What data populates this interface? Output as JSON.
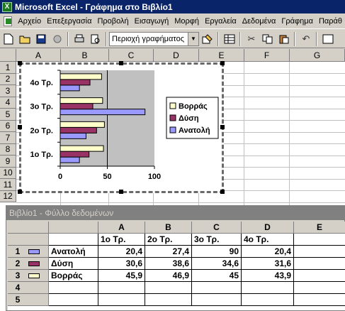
{
  "window": {
    "title": "Microsoft Excel - Γράφημα στο Βιβλίο1",
    "app_icon": "excel-icon"
  },
  "menu": [
    "Αρχείο",
    "Επεξεργασία",
    "Προβολή",
    "Εισαγωγή",
    "Μορφή",
    "Εργαλεία",
    "Δεδομένα",
    "Γράφημα",
    "Παράθ"
  ],
  "toolbar": {
    "chart_object_value": "Περιοχή γραφήματος"
  },
  "sheet": {
    "columns": [
      "A",
      "B",
      "C",
      "D",
      "E",
      "F",
      "G"
    ],
    "rows": [
      "1",
      "2",
      "3",
      "4",
      "5",
      "6",
      "7",
      "8",
      "9",
      "10",
      "11",
      "12"
    ]
  },
  "chart_data": {
    "type": "bar",
    "orientation": "horizontal",
    "categories": [
      "1ο Τρ.",
      "2ο Τρ.",
      "3ο Τρ.",
      "4ο Τρ."
    ],
    "series": [
      {
        "name": "Ανατολή",
        "values": [
          20.4,
          27.4,
          90,
          20.4
        ],
        "color": "#9999ff"
      },
      {
        "name": "Δύση",
        "values": [
          30.6,
          38.6,
          34.6,
          31.6
        ],
        "color": "#993366"
      },
      {
        "name": "Βορράς",
        "values": [
          45.9,
          46.9,
          45,
          43.9
        ],
        "color": "#ffffcc"
      }
    ],
    "x_ticks": [
      "0",
      "50",
      "100"
    ],
    "xlim": [
      0,
      100
    ],
    "plot_background": "#c0c0c0",
    "legend_position": "right",
    "legend_order": [
      "Βορράς",
      "Δύση",
      "Ανατολή"
    ]
  },
  "datasheet": {
    "title": "Βιβλίο1 - Φύλλο δεδομένων",
    "columns": [
      "A",
      "B",
      "C",
      "D",
      "E"
    ],
    "header_row": [
      "1ο Τρ.",
      "2ο Τρ.",
      "3ο Τρ.",
      "4ο Τρ."
    ],
    "rows": [
      {
        "num": "1",
        "label": "Ανατολή",
        "values": [
          "20,4",
          "27,4",
          "90",
          "20,4"
        ]
      },
      {
        "num": "2",
        "label": "Δύση",
        "values": [
          "30,6",
          "38,6",
          "34,6",
          "31,6"
        ]
      },
      {
        "num": "3",
        "label": "Βορράς",
        "values": [
          "45,9",
          "46,9",
          "45",
          "43,9"
        ]
      },
      {
        "num": "4",
        "label": "",
        "values": [
          "",
          "",
          "",
          ""
        ]
      },
      {
        "num": "5",
        "label": "",
        "values": [
          "",
          "",
          "",
          ""
        ]
      }
    ]
  }
}
